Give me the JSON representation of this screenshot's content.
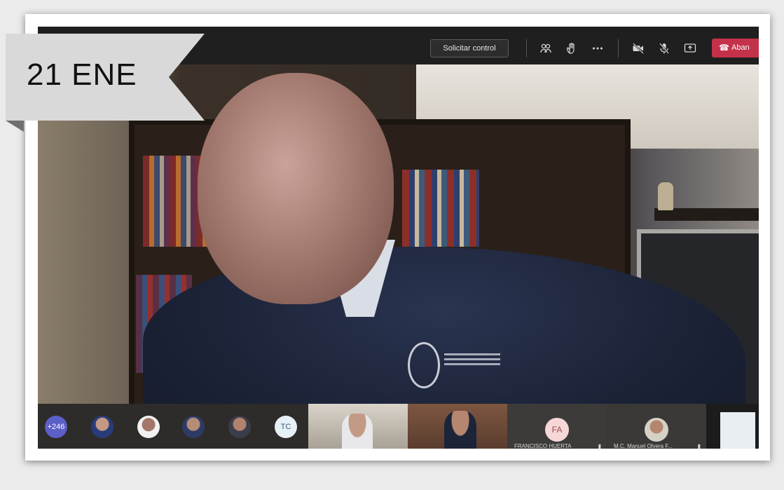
{
  "date_banner": {
    "text": "21 ENE"
  },
  "meeting_toolbar": {
    "request_control_label": "Solicitar control",
    "icons": [
      "participants-icon",
      "raise-hand-icon",
      "more-options-icon",
      "video-off-icon",
      "mic-off-icon",
      "share-screen-icon"
    ],
    "leave_label": "Aban"
  },
  "participants": {
    "overflow_count": "+246",
    "initials_avatar": "TC"
  },
  "video_tiles": [
    {
      "initials": "FA",
      "name": "FRANCISCO HUERTA"
    },
    {
      "name": "M.C. Manuel Olvera F..."
    }
  ],
  "colors": {
    "leave_button": "#c4314b",
    "count_badge": "#5b5fc7",
    "toolbar": "#1f1f1f"
  }
}
